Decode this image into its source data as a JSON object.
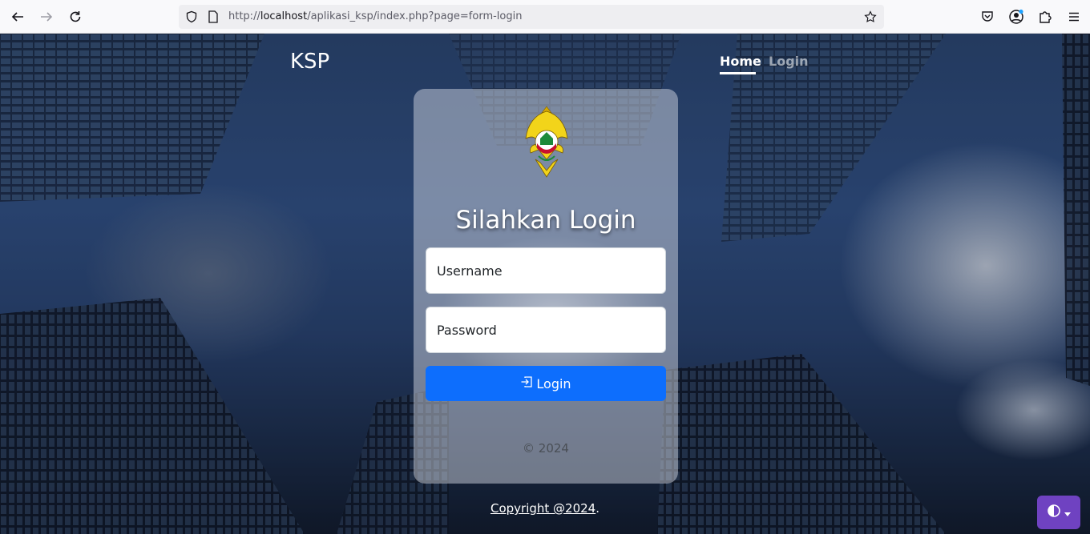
{
  "browser": {
    "url_prefix": "http://",
    "url_host": "localhost",
    "url_path": "/aplikasi_ksp/index.php?page=form-login"
  },
  "navbar": {
    "brand": "KSP",
    "links": [
      {
        "label": "Home",
        "active": true
      },
      {
        "label": "Login",
        "active": false
      }
    ]
  },
  "login_card": {
    "title": "Silahkan Login",
    "username_placeholder": "Username",
    "password_placeholder": "Password",
    "login_button": "Login",
    "footer": "© 2024"
  },
  "footer": {
    "copyright": "Copyright @2024",
    "suffix": "."
  },
  "colors": {
    "primary_button": "#0d6efd",
    "theme_button": "#6f42c1"
  },
  "icons": {
    "back": "arrow-left-icon",
    "forward": "arrow-right-icon",
    "reload": "reload-icon",
    "shield": "shield-icon",
    "page": "page-icon",
    "bookmark": "star-icon",
    "pocket": "pocket-icon",
    "account": "account-icon",
    "extensions": "puzzle-icon",
    "menu": "hamburger-menu-icon",
    "login": "login-icon",
    "theme": "contrast-icon"
  }
}
